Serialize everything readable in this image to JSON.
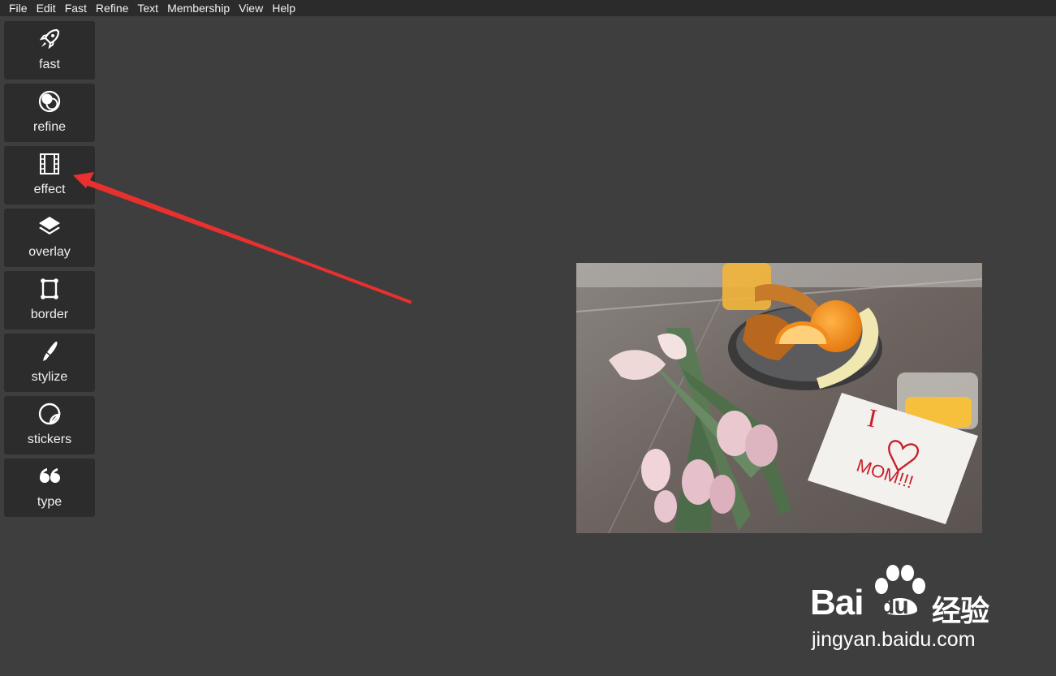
{
  "menu": [
    "File",
    "Edit",
    "Fast",
    "Refine",
    "Text",
    "Membership",
    "View",
    "Help"
  ],
  "tools": [
    {
      "label": "fast",
      "icon": "rocket-icon"
    },
    {
      "label": "refine",
      "icon": "circles-icon"
    },
    {
      "label": "effect",
      "icon": "film-icon"
    },
    {
      "label": "overlay",
      "icon": "layers-icon"
    },
    {
      "label": "border",
      "icon": "frame-icon"
    },
    {
      "label": "stylize",
      "icon": "brush-icon"
    },
    {
      "label": "stickers",
      "icon": "sticker-icon"
    },
    {
      "label": "type",
      "icon": "quote-icon"
    }
  ],
  "photo": {
    "note_text_1": "I",
    "note_text_2": "MOM!!!"
  },
  "watermark": {
    "brand": "Bai",
    "brand2": "du",
    "brand_cn": "经验",
    "url": "jingyan.baidu.com"
  },
  "colors": {
    "arrow": "#e8312f",
    "accent": "#ffffff"
  }
}
